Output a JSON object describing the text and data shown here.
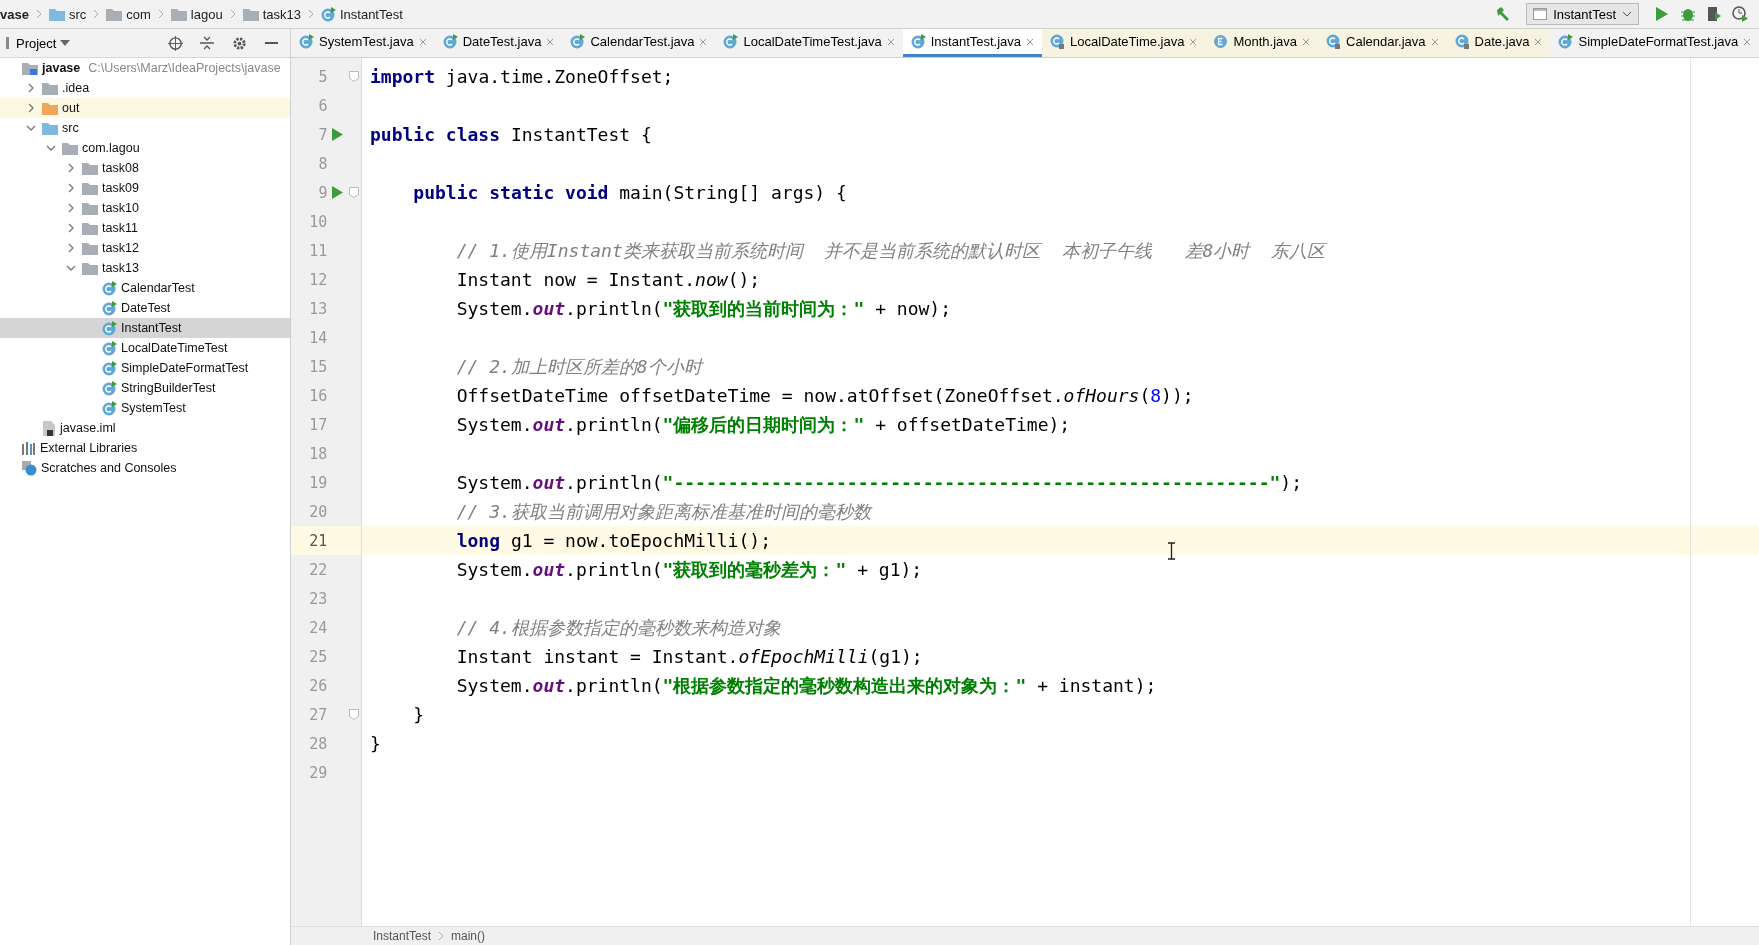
{
  "breadcrumbs": [
    {
      "label": "vase",
      "kind": "module"
    },
    {
      "label": "src",
      "kind": "source"
    },
    {
      "label": "com",
      "kind": "folder"
    },
    {
      "label": "lagou",
      "kind": "folder"
    },
    {
      "label": "task13",
      "kind": "folder"
    },
    {
      "label": "InstantTest",
      "kind": "class"
    }
  ],
  "run_config": {
    "label": "InstantTest"
  },
  "project_panel": {
    "title": "Project"
  },
  "tree": [
    {
      "label": "javase",
      "kind": "module",
      "path": "C:\\Users\\Marz\\IdeaProjects\\javase",
      "selected": false,
      "highlighted": false,
      "children": [
        {
          "label": ".idea",
          "kind": "folder",
          "expanded": false,
          "selected": false,
          "highlighted": false
        },
        {
          "label": "out",
          "kind": "excluded",
          "expanded": false,
          "selected": false,
          "highlighted": true
        },
        {
          "label": "src",
          "kind": "source",
          "expanded": true,
          "selected": false,
          "highlighted": false,
          "children": [
            {
              "label": "com.lagou",
              "kind": "package",
              "expanded": true,
              "selected": false,
              "highlighted": false,
              "children": [
                {
                  "label": "task08",
                  "kind": "package",
                  "expanded": false,
                  "selected": false,
                  "highlighted": false
                },
                {
                  "label": "task09",
                  "kind": "package",
                  "expanded": false,
                  "selected": false,
                  "highlighted": false
                },
                {
                  "label": "task10",
                  "kind": "package",
                  "expanded": false,
                  "selected": false,
                  "highlighted": false
                },
                {
                  "label": "task11",
                  "kind": "package",
                  "expanded": false,
                  "selected": false,
                  "highlighted": false
                },
                {
                  "label": "task12",
                  "kind": "package",
                  "expanded": false,
                  "selected": false,
                  "highlighted": false
                },
                {
                  "label": "task13",
                  "kind": "package",
                  "expanded": true,
                  "selected": false,
                  "highlighted": false,
                  "children": [
                    {
                      "label": "CalendarTest",
                      "kind": "class",
                      "selected": false,
                      "highlighted": false
                    },
                    {
                      "label": "DateTest",
                      "kind": "class",
                      "selected": false,
                      "highlighted": false
                    },
                    {
                      "label": "InstantTest",
                      "kind": "class",
                      "selected": true,
                      "highlighted": false
                    },
                    {
                      "label": "LocalDateTimeTest",
                      "kind": "class",
                      "selected": false,
                      "highlighted": false
                    },
                    {
                      "label": "SimpleDateFormatTest",
                      "kind": "class",
                      "selected": false,
                      "highlighted": false
                    },
                    {
                      "label": "StringBuilderTest",
                      "kind": "class",
                      "selected": false,
                      "highlighted": false
                    },
                    {
                      "label": "SystemTest",
                      "kind": "class",
                      "selected": false,
                      "highlighted": false
                    }
                  ]
                }
              ]
            }
          ]
        },
        {
          "label": "javase.iml",
          "kind": "iml",
          "selected": false,
          "highlighted": false
        }
      ]
    },
    {
      "label": "External Libraries",
      "kind": "libraries",
      "selected": false,
      "highlighted": false
    },
    {
      "label": "Scratches and Consoles",
      "kind": "scratches",
      "selected": false,
      "highlighted": false
    }
  ],
  "tabs": [
    {
      "label": "SystemTest.java",
      "kind": "class",
      "selected": false
    },
    {
      "label": "DateTest.java",
      "kind": "class",
      "selected": false
    },
    {
      "label": "CalendarTest.java",
      "kind": "class",
      "selected": false
    },
    {
      "label": "LocalDateTimeTest.java",
      "kind": "class",
      "selected": false
    },
    {
      "label": "InstantTest.java",
      "kind": "class",
      "selected": true
    },
    {
      "label": "LocalDateTime.java",
      "kind": "library",
      "selected": false
    },
    {
      "label": "Month.java",
      "kind": "enum",
      "selected": false
    },
    {
      "label": "Calendar.java",
      "kind": "library",
      "selected": false
    },
    {
      "label": "Date.java",
      "kind": "library",
      "selected": false
    },
    {
      "label": "SimpleDateFormatTest.java",
      "kind": "class",
      "selected": false
    }
  ],
  "code_lines": [
    {
      "number": "5",
      "kind": "file",
      "fold": true,
      "run": false,
      "current": false,
      "tokens": [
        {
          "kind": "keyword",
          "text": "import"
        },
        {
          "kind": "plain",
          "text": " java.time.ZoneOffset;"
        }
      ]
    },
    {
      "number": "6",
      "kind": "file",
      "fold": false,
      "run": false,
      "current": false
    },
    {
      "number": "7",
      "kind": "file",
      "fold": false,
      "run": true,
      "current": false,
      "tokens": [
        {
          "kind": "keyword",
          "text": "public class"
        },
        {
          "kind": "plain",
          "text": " InstantTest {"
        }
      ]
    },
    {
      "number": "8",
      "kind": "file",
      "fold": false,
      "run": false,
      "current": false
    },
    {
      "number": "9",
      "kind": "member",
      "fold": true,
      "run": true,
      "current": false,
      "tokens": [
        {
          "kind": "keyword",
          "text": "public static void"
        },
        {
          "kind": "plain",
          "text": " main(String[] args) {"
        }
      ]
    },
    {
      "number": "10",
      "kind": "file",
      "fold": false,
      "run": false,
      "current": false
    },
    {
      "number": "11",
      "kind": "statement",
      "fold": false,
      "run": false,
      "current": false,
      "tokens": [
        {
          "kind": "comment",
          "text": "// 1.使用Instant类来获取当前系统时间  并不是当前系统的默认时区  本初子午线   差8小时  东八区"
        }
      ]
    },
    {
      "number": "12",
      "kind": "statement",
      "fold": false,
      "run": false,
      "current": false,
      "tokens": [
        {
          "kind": "plain",
          "text": "Instant now = Instant."
        },
        {
          "kind": "static-method",
          "text": "now"
        },
        {
          "kind": "plain",
          "text": "();"
        }
      ]
    },
    {
      "number": "13",
      "kind": "statement",
      "fold": false,
      "run": false,
      "current": false,
      "tokens": [
        {
          "kind": "plain",
          "text": "System."
        },
        {
          "kind": "static-field",
          "text": "out"
        },
        {
          "kind": "plain",
          "text": ".println("
        },
        {
          "kind": "string",
          "text": "\"获取到的当前时间为：\""
        },
        {
          "kind": "plain",
          "text": " + now);"
        }
      ]
    },
    {
      "number": "14",
      "kind": "file",
      "fold": false,
      "run": false,
      "current": false
    },
    {
      "number": "15",
      "kind": "statement",
      "fold": false,
      "run": false,
      "current": false,
      "tokens": [
        {
          "kind": "comment",
          "text": "// 2.加上时区所差的8个小时"
        }
      ]
    },
    {
      "number": "16",
      "kind": "statement",
      "fold": false,
      "run": false,
      "current": false,
      "tokens": [
        {
          "kind": "plain",
          "text": "OffsetDateTime offsetDateTime = now.atOffset(ZoneOffset."
        },
        {
          "kind": "static-method",
          "text": "ofHours"
        },
        {
          "kind": "plain",
          "text": "("
        },
        {
          "kind": "number",
          "text": "8"
        },
        {
          "kind": "plain",
          "text": "));"
        }
      ]
    },
    {
      "number": "17",
      "kind": "statement",
      "fold": false,
      "run": false,
      "current": false,
      "tokens": [
        {
          "kind": "plain",
          "text": "System."
        },
        {
          "kind": "static-field",
          "text": "out"
        },
        {
          "kind": "plain",
          "text": ".println("
        },
        {
          "kind": "string",
          "text": "\"偏移后的日期时间为：\""
        },
        {
          "kind": "plain",
          "text": " + offsetDateTime);"
        }
      ]
    },
    {
      "number": "18",
      "kind": "file",
      "fold": false,
      "run": false,
      "current": false
    },
    {
      "number": "19",
      "kind": "statement",
      "fold": false,
      "run": false,
      "current": false,
      "tokens": [
        {
          "kind": "plain",
          "text": "System."
        },
        {
          "kind": "static-field",
          "text": "out"
        },
        {
          "kind": "plain",
          "text": ".println("
        },
        {
          "kind": "string",
          "text": "\"-------------------------------------------------------\""
        },
        {
          "kind": "plain",
          "text": ");"
        }
      ]
    },
    {
      "number": "20",
      "kind": "statement",
      "fold": false,
      "run": false,
      "current": false,
      "tokens": [
        {
          "kind": "comment",
          "text": "// 3.获取当前调用对象距离标准基准时间的毫秒数"
        }
      ]
    },
    {
      "number": "21",
      "kind": "statement",
      "fold": false,
      "run": false,
      "current": true,
      "tokens": [
        {
          "kind": "keyword",
          "text": "long"
        },
        {
          "kind": "plain",
          "text": " g1 = now.toEpochMilli();"
        }
      ]
    },
    {
      "number": "22",
      "kind": "statement",
      "fold": false,
      "run": false,
      "current": false,
      "tokens": [
        {
          "kind": "plain",
          "text": "System."
        },
        {
          "kind": "static-field",
          "text": "out"
        },
        {
          "kind": "plain",
          "text": ".println("
        },
        {
          "kind": "string",
          "text": "\"获取到的毫秒差为：\""
        },
        {
          "kind": "plain",
          "text": " + g1);"
        }
      ]
    },
    {
      "number": "23",
      "kind": "file",
      "fold": false,
      "run": false,
      "current": false
    },
    {
      "number": "24",
      "kind": "statement",
      "fold": false,
      "run": false,
      "current": false,
      "tokens": [
        {
          "kind": "comment",
          "text": "// 4.根据参数指定的毫秒数来构造对象"
        }
      ]
    },
    {
      "number": "25",
      "kind": "statement",
      "fold": false,
      "run": false,
      "current": false,
      "tokens": [
        {
          "kind": "plain",
          "text": "Instant instant = Instant."
        },
        {
          "kind": "static-method",
          "text": "ofEpochMilli"
        },
        {
          "kind": "plain",
          "text": "(g1);"
        }
      ]
    },
    {
      "number": "26",
      "kind": "statement",
      "fold": false,
      "run": false,
      "current": false,
      "tokens": [
        {
          "kind": "plain",
          "text": "System."
        },
        {
          "kind": "static-field",
          "text": "out"
        },
        {
          "kind": "plain",
          "text": ".println("
        },
        {
          "kind": "string",
          "text": "\"根据参数指定的毫秒数构造出来的对象为：\""
        },
        {
          "kind": "plain",
          "text": " + instant);"
        }
      ]
    },
    {
      "number": "27",
      "kind": "member",
      "fold": true,
      "run": false,
      "current": false,
      "tokens": [
        {
          "kind": "plain",
          "text": "}"
        }
      ]
    },
    {
      "number": "28",
      "kind": "file",
      "fold": false,
      "run": false,
      "current": false,
      "tokens": [
        {
          "kind": "plain",
          "text": "}"
        }
      ]
    },
    {
      "number": "29",
      "kind": "file",
      "fold": false,
      "run": false,
      "current": false
    }
  ],
  "editor_breadcrumbs": [
    "InstantTest",
    "main()"
  ]
}
